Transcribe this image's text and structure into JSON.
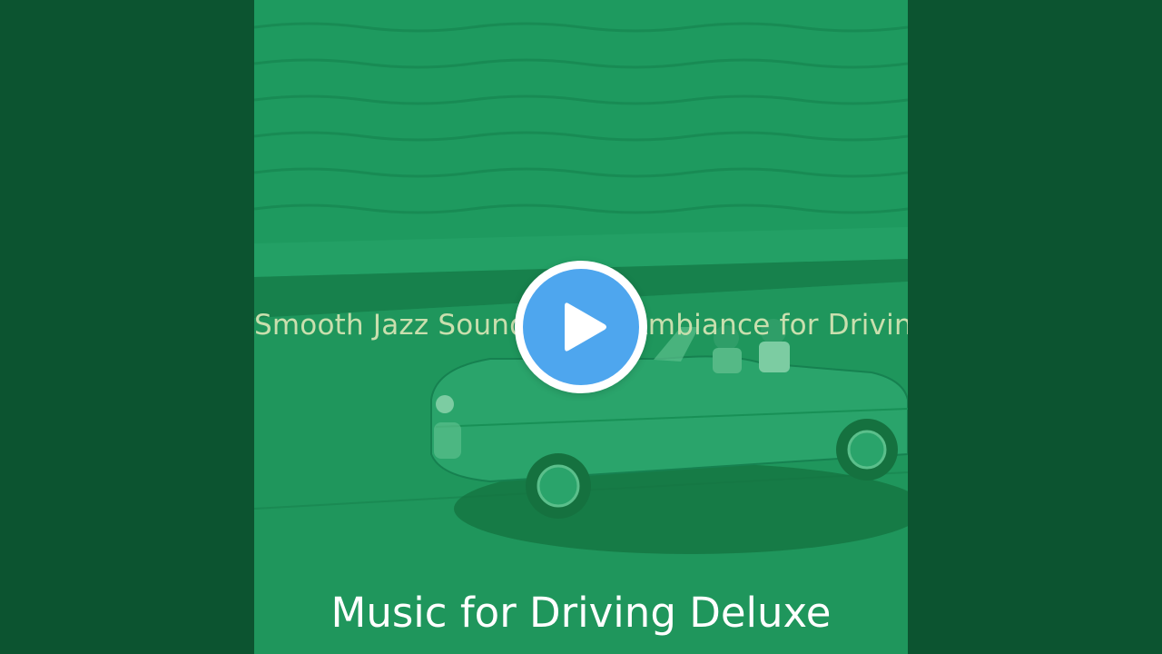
{
  "video": {
    "subtitle": "Smooth Jazz Soundtrack - Ambiance for Driving",
    "album_title": "Music for Driving Deluxe",
    "play_icon": "play-icon"
  },
  "colors": {
    "side_bars": "#0c5430",
    "cover_tint": "#1a9058",
    "play_button_fill": "#4ea6ee",
    "play_button_ring": "#ffffff",
    "subtitle_text": "#c9dfae",
    "title_text": "#ffffff"
  }
}
